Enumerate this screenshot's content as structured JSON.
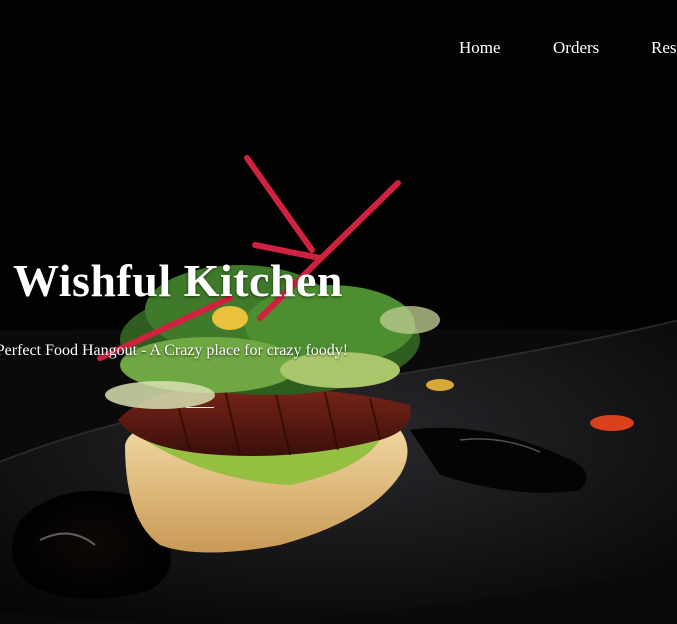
{
  "nav": {
    "items": [
      {
        "label": "Home"
      },
      {
        "label": "Orders"
      },
      {
        "label": "Res"
      }
    ]
  },
  "hero": {
    "title": "Wishful Kitchen",
    "tagline": "t of Perfect Food Hangout - A Crazy place for crazy foody!"
  },
  "icons": {
    "hero_image": "plated-dish-image"
  },
  "colors": {
    "text": "#ffffff",
    "background": "#000000",
    "plate": "#161618",
    "garnish_red": "#c8233a",
    "greens": "#3f7a2a",
    "rice": "#e8c98e",
    "meat": "#5a1a14"
  }
}
